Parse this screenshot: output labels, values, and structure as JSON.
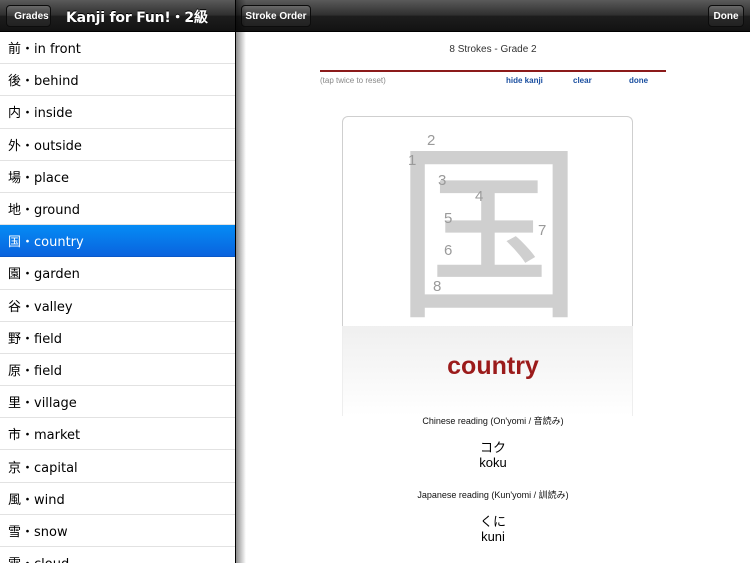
{
  "master": {
    "back_label": "Grades",
    "title": "Kanji for Fun!・2級",
    "items": [
      {
        "label": "前・in front"
      },
      {
        "label": "後・behind"
      },
      {
        "label": "内・inside"
      },
      {
        "label": "外・outside"
      },
      {
        "label": "場・place"
      },
      {
        "label": "地・ground"
      },
      {
        "label": "国・country",
        "selected": true
      },
      {
        "label": "園・garden"
      },
      {
        "label": "谷・valley"
      },
      {
        "label": "野・field"
      },
      {
        "label": "原・field"
      },
      {
        "label": "里・village"
      },
      {
        "label": "市・market"
      },
      {
        "label": "京・capital"
      },
      {
        "label": "風・wind"
      },
      {
        "label": "雪・snow"
      },
      {
        "label": "雲・cloud"
      }
    ]
  },
  "detail": {
    "stroke_order_label": "Stroke Order",
    "done_label": "Done",
    "strokes_info": "8 Strokes - Grade 2",
    "tap_hint": "(tap twice to reset)",
    "hide_kanji_label": "hide kanji",
    "clear_label": "clear",
    "done_link_label": "done",
    "kanji": "国",
    "stroke_numbers": [
      "1",
      "2",
      "3",
      "4",
      "5",
      "6",
      "7",
      "8"
    ],
    "meaning": "country",
    "onyomi_label": "Chinese reading (On'yomi / 音読み)",
    "onyomi_kana": "コク",
    "onyomi_romaji": "koku",
    "kunyomi_label": "Japanese reading (Kun'yomi / 訓読み)",
    "kunyomi_kana": "くに",
    "kunyomi_romaji": "kuni"
  },
  "colors": {
    "selection": "#0a6fe8",
    "meaning": "#9b1b1b",
    "accent_rule": "#8b1a1a",
    "link": "#1a4fa0"
  }
}
